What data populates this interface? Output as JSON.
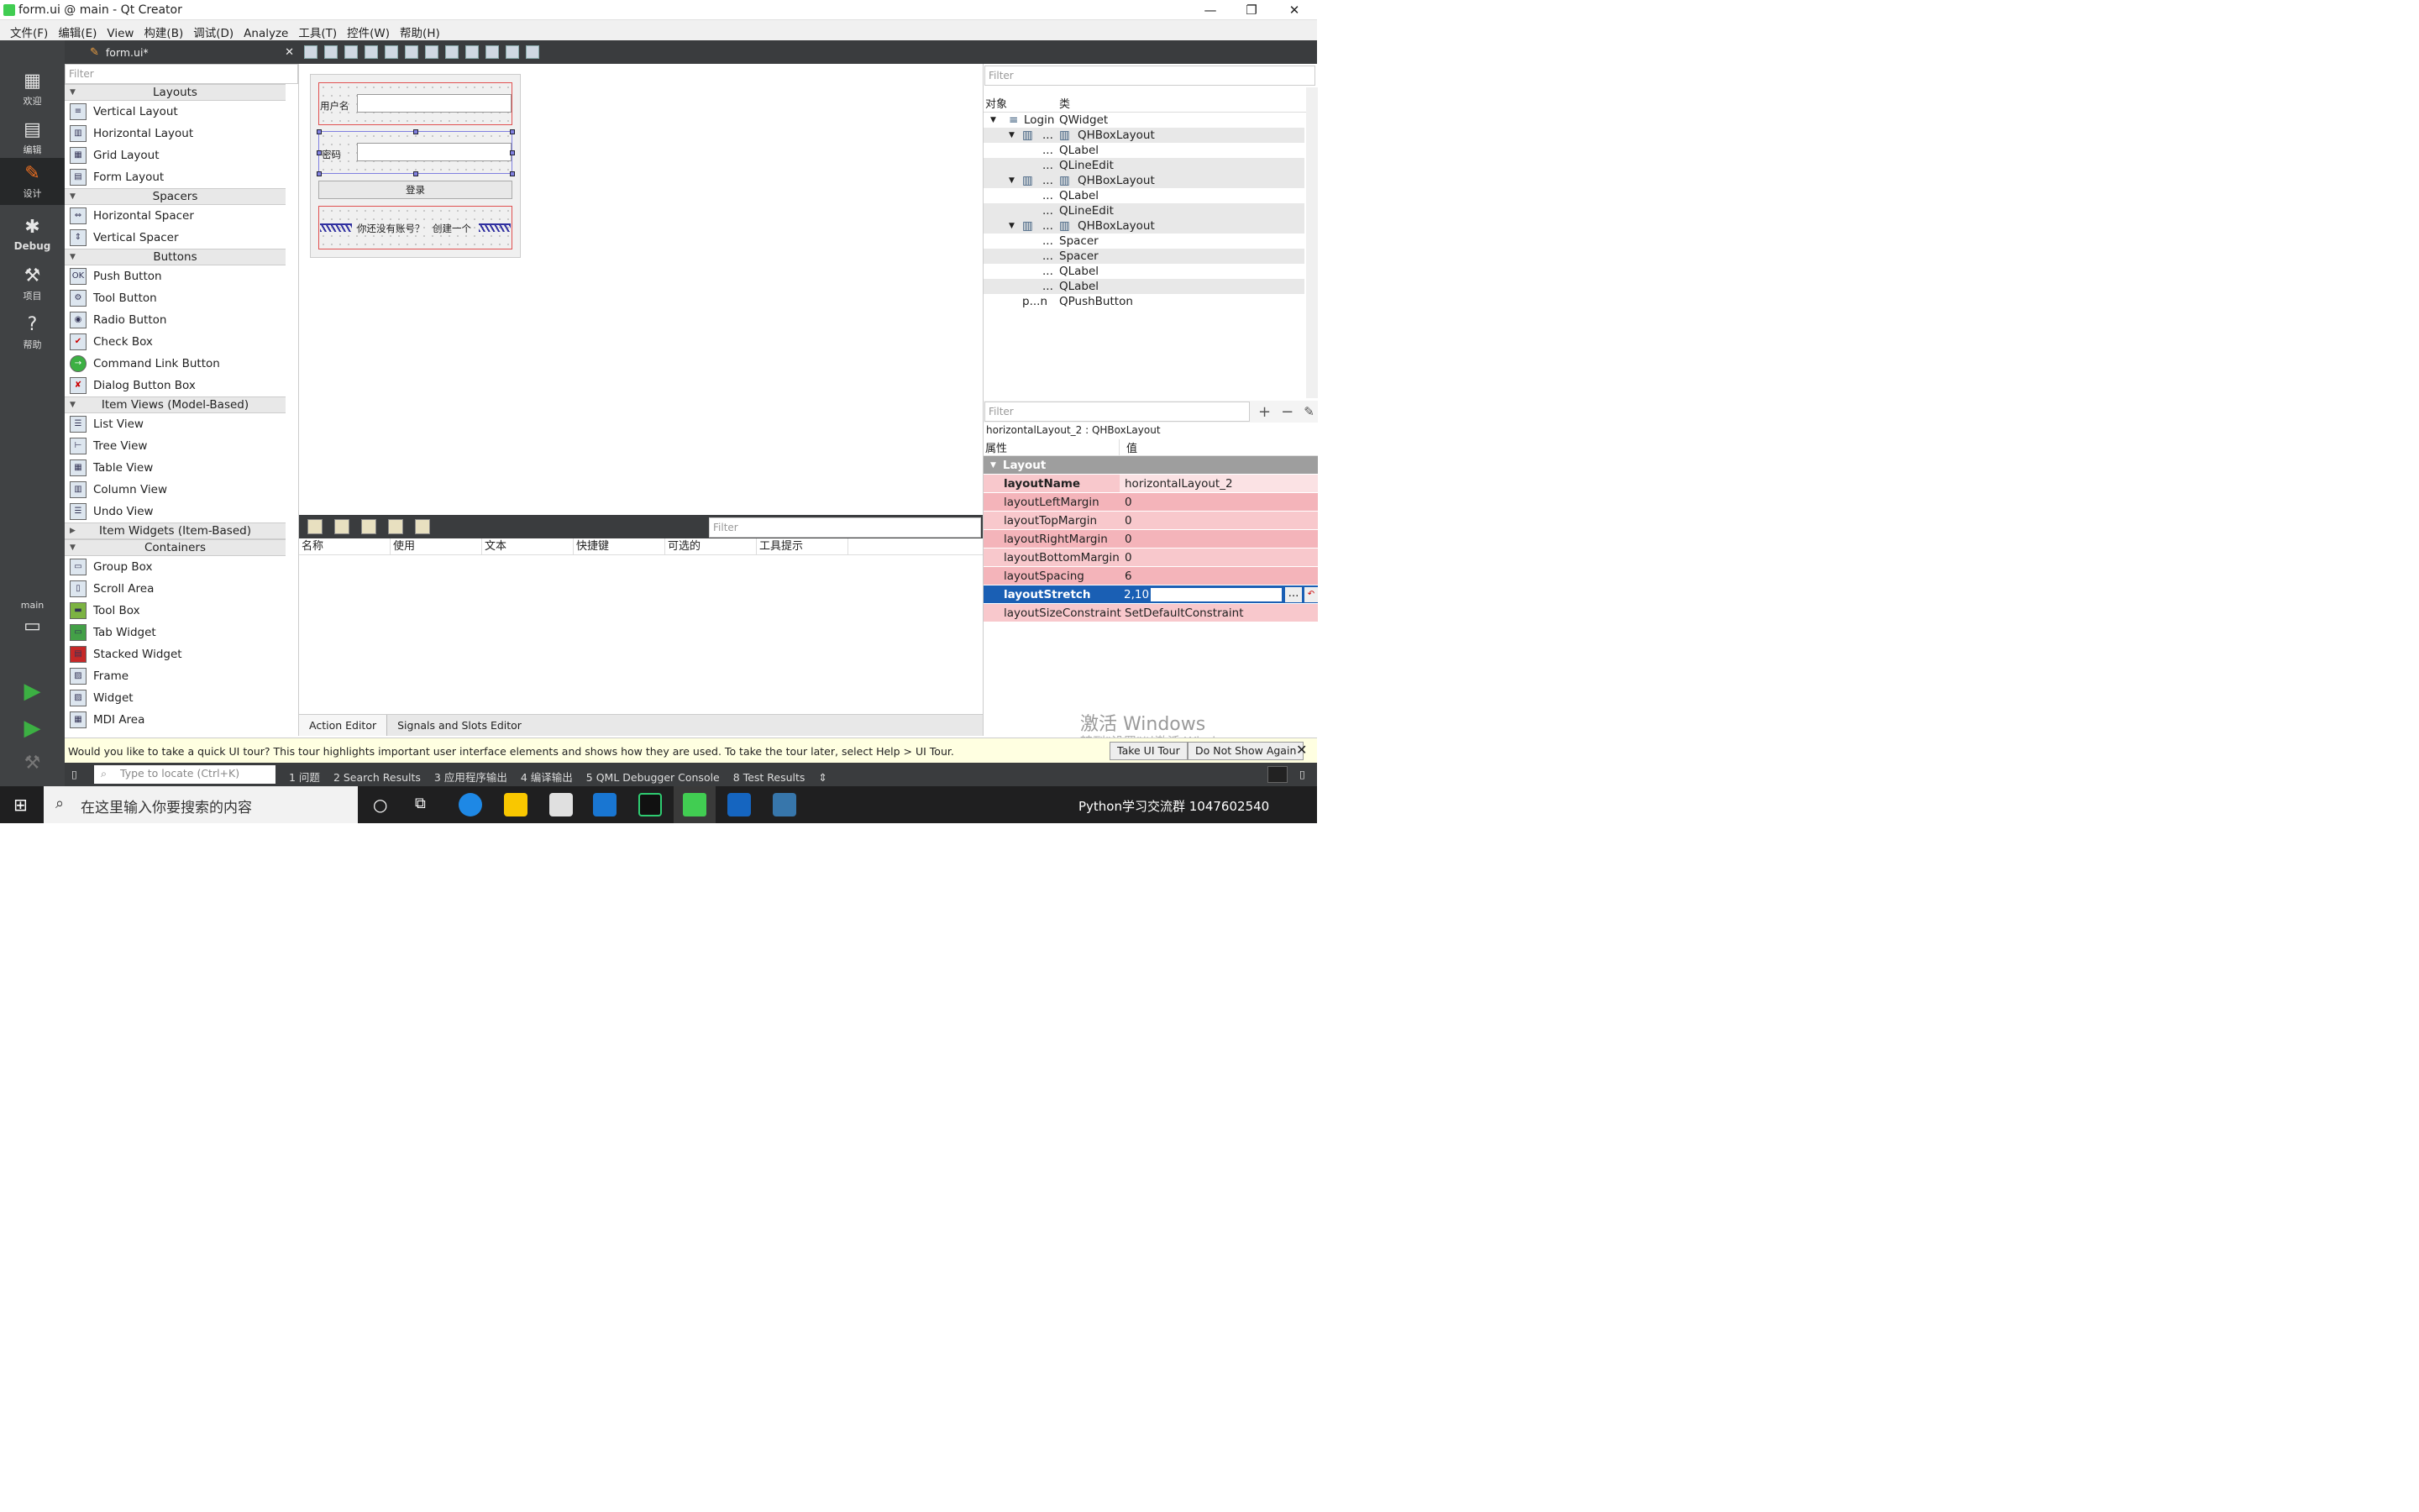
{
  "window": {
    "title": "form.ui @ main - Qt Creator",
    "controls": [
      "—",
      "❐",
      "✕"
    ]
  },
  "menu": [
    "文件(F)",
    "编辑(E)",
    "View",
    "构建(B)",
    "调试(D)",
    "Analyze",
    "工具(T)",
    "控件(W)",
    "帮助(H)"
  ],
  "modes": [
    {
      "label": "欢迎",
      "icon": "grid-icon"
    },
    {
      "label": "编辑",
      "icon": "edit-doc-icon"
    },
    {
      "label": "设计",
      "icon": "pencil-icon"
    },
    {
      "label": "Debug",
      "icon": "bug-icon"
    },
    {
      "label": "项目",
      "icon": "wrench-icon"
    },
    {
      "label": "帮助",
      "icon": "help-icon"
    }
  ],
  "kit": {
    "name": "main"
  },
  "editor": {
    "file": "form.ui*"
  },
  "widgetbox": {
    "filter_placeholder": "Filter",
    "categories": {
      "layouts": "Layouts",
      "spacers": "Spacers",
      "buttons": "Buttons",
      "item_views": "Item Views (Model-Based)",
      "item_widgets": "Item Widgets (Item-Based)",
      "containers": "Containers"
    },
    "layouts": [
      "Vertical Layout",
      "Horizontal Layout",
      "Grid Layout",
      "Form Layout"
    ],
    "spacers": [
      "Horizontal Spacer",
      "Vertical Spacer"
    ],
    "buttons": [
      "Push Button",
      "Tool Button",
      "Radio Button",
      "Check Box",
      "Command Link Button",
      "Dialog Button Box"
    ],
    "item_views": [
      "List View",
      "Tree View",
      "Table View",
      "Column View",
      "Undo View"
    ],
    "containers": [
      "Group Box",
      "Scroll Area",
      "Tool Box",
      "Tab Widget",
      "Stacked Widget",
      "Frame",
      "Widget",
      "MDI Area"
    ]
  },
  "form": {
    "username_label": "用户名",
    "password_label": "密码",
    "login_button": "登录",
    "no_account": "你还没有账号？",
    "create_one": "创建一个"
  },
  "action_editor": {
    "filter_placeholder": "Filter",
    "columns": [
      "名称",
      "使用",
      "文本",
      "快捷键",
      "可选的",
      "工具提示"
    ],
    "tabs": [
      "Action Editor",
      "Signals and Slots Editor"
    ]
  },
  "object_inspector": {
    "filter_placeholder": "Filter",
    "headers": [
      "对象",
      "类"
    ],
    "rows": [
      {
        "obj": "Login",
        "cls": "QWidget",
        "level": 0,
        "expanded": true
      },
      {
        "obj": "...",
        "cls": "QHBoxLayout",
        "level": 1,
        "expanded": true
      },
      {
        "obj": "...",
        "cls": "QLabel",
        "level": 2
      },
      {
        "obj": "...",
        "cls": "QLineEdit",
        "level": 2
      },
      {
        "obj": "...",
        "cls": "QHBoxLayout",
        "level": 1,
        "expanded": true
      },
      {
        "obj": "...",
        "cls": "QLabel",
        "level": 2
      },
      {
        "obj": "...",
        "cls": "QLineEdit",
        "level": 2
      },
      {
        "obj": "...",
        "cls": "QHBoxLayout",
        "level": 1,
        "expanded": true
      },
      {
        "obj": "...",
        "cls": "Spacer",
        "level": 2
      },
      {
        "obj": "...",
        "cls": "Spacer",
        "level": 2
      },
      {
        "obj": "...",
        "cls": "QLabel",
        "level": 2
      },
      {
        "obj": "...",
        "cls": "QLabel",
        "level": 2
      },
      {
        "obj": "p...n",
        "cls": "QPushButton",
        "level": 1
      }
    ]
  },
  "property_editor": {
    "filter_placeholder": "Filter",
    "object_label": "horizontalLayout_2 : QHBoxLayout",
    "headers": [
      "属性",
      "值"
    ],
    "section": "Layout",
    "props": [
      {
        "name": "layoutName",
        "value": "horizontalLayout_2"
      },
      {
        "name": "layoutLeftMargin",
        "value": "0"
      },
      {
        "name": "layoutTopMargin",
        "value": "0"
      },
      {
        "name": "layoutRightMargin",
        "value": "0"
      },
      {
        "name": "layoutBottomMargin",
        "value": "0"
      },
      {
        "name": "layoutSpacing",
        "value": "6"
      },
      {
        "name": "layoutStretch",
        "value": "2,10"
      },
      {
        "name": "layoutSizeConstraint",
        "value": "SetDefaultConstraint"
      }
    ],
    "ellipsis": "..."
  },
  "tour": {
    "message": "Would you like to take a quick UI tour? This tour highlights important user interface elements and shows how they are used. To take the tour later, select Help > UI Tour.",
    "take": "Take UI Tour",
    "dismiss": "Do Not Show Again"
  },
  "status": {
    "locator_placeholder": "Type to locate (Ctrl+K)",
    "panes": [
      "1  问题",
      "2  Search Results",
      "3  应用程序输出",
      "4  编译输出",
      "5  QML Debugger Console",
      "8  Test Results"
    ]
  },
  "watermark": {
    "line1": "激活 Windows",
    "line2": "转到\"设置\"以激活 Windows。"
  },
  "taskbar": {
    "search": "在这里输入你要搜索的内容",
    "right_text": "Python学习交流群 1047602540"
  },
  "colors": {
    "accent": "#1a5fb4",
    "dark": "#404244",
    "prop_pink": "#f8c8cc",
    "prop_pink_alt": "#f4b4ba"
  }
}
